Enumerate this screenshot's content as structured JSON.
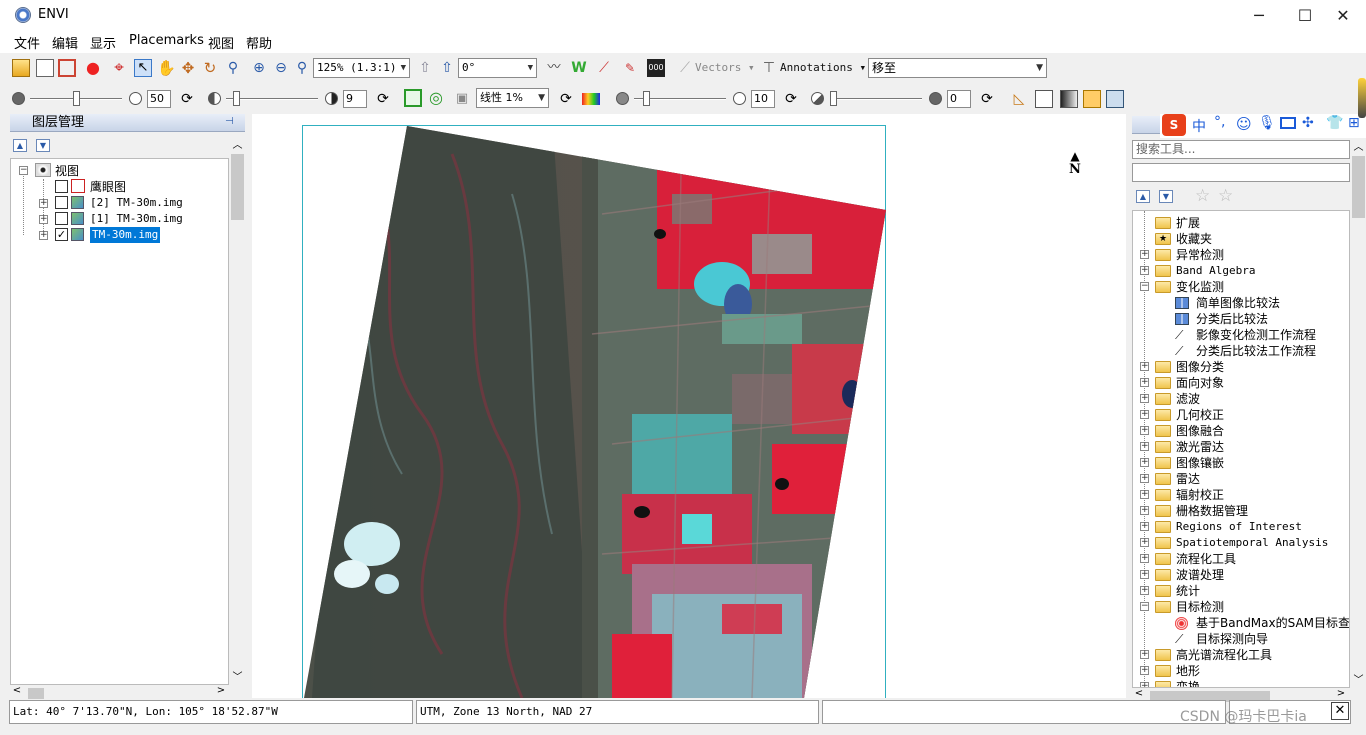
{
  "window": {
    "title": "ENVI",
    "minimize": "─",
    "maximize": "☐",
    "close": "✕"
  },
  "menu": [
    "文件",
    "编辑",
    "显示",
    "Placemarks",
    "视图",
    "帮助"
  ],
  "toolbar1": {
    "zoom_value": "125% (1.3:1)",
    "rotate_value": "0°",
    "vectors_label": "Vectors",
    "annotations_label": "Annotations",
    "goto_value": "移至"
  },
  "toolbar2": {
    "brightness_value": "50",
    "contrast_value": "9",
    "stretch_value": "线性 1%",
    "sharpen_value": "10",
    "transparency_value": "0"
  },
  "layer_panel": {
    "title": "图层管理",
    "root": "视图",
    "items": [
      {
        "label": "鹰眼图",
        "checked": false
      },
      {
        "label": "[2] TM-30m.img",
        "checked": false
      },
      {
        "label": "[1] TM-30m.img",
        "checked": false
      },
      {
        "label": "TM-30m.img",
        "checked": true
      }
    ]
  },
  "view": {
    "north_label": "N"
  },
  "toolbox": {
    "search_placeholder": "搜索工具...",
    "items": [
      {
        "label": "扩展",
        "level": 0,
        "type": "folder",
        "expander": ""
      },
      {
        "label": "收藏夹",
        "level": 0,
        "type": "folder-star",
        "expander": ""
      },
      {
        "label": "异常检测",
        "level": 0,
        "type": "folder",
        "expander": "+"
      },
      {
        "label": "Band Algebra",
        "level": 0,
        "type": "folder",
        "expander": "+"
      },
      {
        "label": "变化监测",
        "level": 0,
        "type": "folder",
        "expander": "−"
      },
      {
        "label": "简单图像比较法",
        "level": 1,
        "type": "tool",
        "expander": ""
      },
      {
        "label": "分类后比较法",
        "level": 1,
        "type": "tool",
        "expander": ""
      },
      {
        "label": "影像变化检测工作流程",
        "level": 1,
        "type": "wand",
        "expander": ""
      },
      {
        "label": "分类后比较法工作流程",
        "level": 1,
        "type": "wand",
        "expander": ""
      },
      {
        "label": "图像分类",
        "level": 0,
        "type": "folder",
        "expander": "+"
      },
      {
        "label": "面向对象",
        "level": 0,
        "type": "folder",
        "expander": "+"
      },
      {
        "label": "滤波",
        "level": 0,
        "type": "folder",
        "expander": "+"
      },
      {
        "label": "几何校正",
        "level": 0,
        "type": "folder",
        "expander": "+"
      },
      {
        "label": "图像融合",
        "level": 0,
        "type": "folder",
        "expander": "+"
      },
      {
        "label": "激光雷达",
        "level": 0,
        "type": "folder",
        "expander": "+"
      },
      {
        "label": "图像镶嵌",
        "level": 0,
        "type": "folder",
        "expander": "+"
      },
      {
        "label": "雷达",
        "level": 0,
        "type": "folder",
        "expander": "+"
      },
      {
        "label": "辐射校正",
        "level": 0,
        "type": "folder",
        "expander": "+"
      },
      {
        "label": "栅格数据管理",
        "level": 0,
        "type": "folder",
        "expander": "+"
      },
      {
        "label": "Regions of Interest",
        "level": 0,
        "type": "folder",
        "expander": "+"
      },
      {
        "label": "Spatiotemporal Analysis",
        "level": 0,
        "type": "folder",
        "expander": "+"
      },
      {
        "label": "流程化工具",
        "level": 0,
        "type": "folder",
        "expander": "+"
      },
      {
        "label": "波谱处理",
        "level": 0,
        "type": "folder",
        "expander": "+"
      },
      {
        "label": "统计",
        "level": 0,
        "type": "folder",
        "expander": "+"
      },
      {
        "label": "目标检测",
        "level": 0,
        "type": "folder",
        "expander": "−"
      },
      {
        "label": "基于BandMax的SAM目标查找向",
        "level": 1,
        "type": "target",
        "expander": ""
      },
      {
        "label": "目标探测向导",
        "level": 1,
        "type": "wand",
        "expander": ""
      },
      {
        "label": "高光谱流程化工具",
        "level": 0,
        "type": "folder",
        "expander": "+"
      },
      {
        "label": "地形",
        "level": 0,
        "type": "folder",
        "expander": "+"
      },
      {
        "label": "变换",
        "level": 0,
        "type": "folder",
        "expander": "+"
      }
    ]
  },
  "status": {
    "coords": "Lat: 40° 7'13.70\"N, Lon: 105° 18'52.87\"W",
    "projection": "UTM, Zone 13 North, NAD 27",
    "field3": "",
    "watermark": "CSDN @玛卡巴卡ia"
  },
  "colors": {
    "accent": "#0078d7",
    "image_red": "#e0203a",
    "image_cyan": "#5ad8d8"
  }
}
